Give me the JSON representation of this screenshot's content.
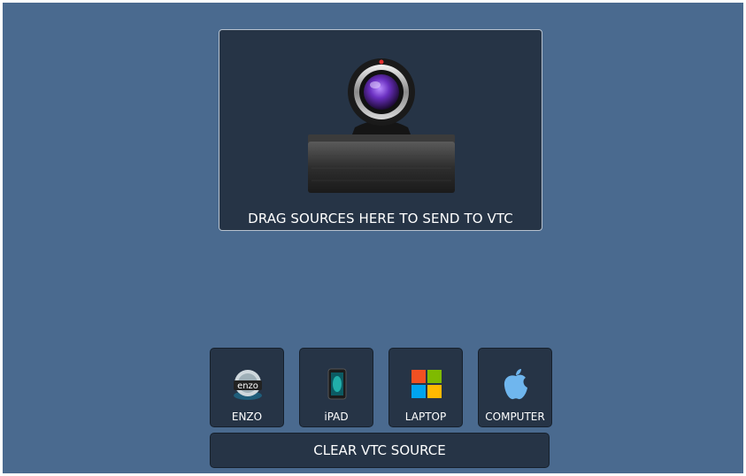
{
  "drop_zone": {
    "caption": "DRAG SOURCES HERE TO SEND TO VTC",
    "icon": "webcam-icon"
  },
  "sources": [
    {
      "label": "ENZO",
      "icon": "enzo-icon"
    },
    {
      "label": "iPAD",
      "icon": "ipad-icon"
    },
    {
      "label": "LAPTOP",
      "icon": "windows-icon"
    },
    {
      "label": "COMPUTER",
      "icon": "apple-icon"
    }
  ],
  "clear_button": {
    "label": "CLEAR VTC SOURCE"
  },
  "colors": {
    "background": "#4a6a8f",
    "panel": "#263446",
    "text": "#ffffff"
  }
}
